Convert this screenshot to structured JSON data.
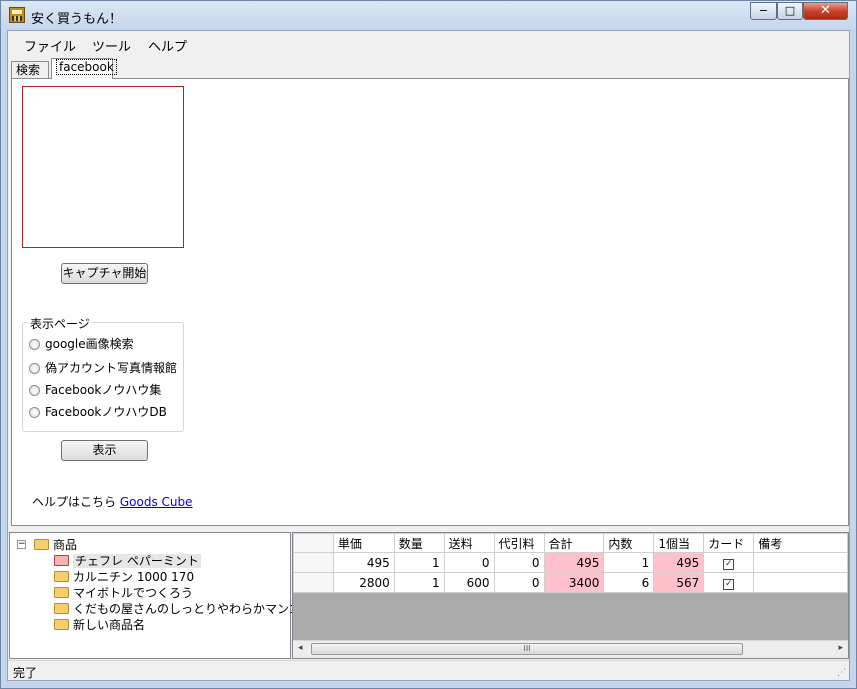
{
  "window": {
    "title": "安く買うもん！",
    "minimize": "−",
    "maximize": "□",
    "close": "✕"
  },
  "menu": [
    "ファイル",
    "ツール",
    "ヘルプ"
  ],
  "tabs": [
    {
      "label": "検索",
      "active": false
    },
    {
      "label": "facebook",
      "active": true
    }
  ],
  "capture_button": "キャプチャ開始",
  "display_group": {
    "label": "表示ページ",
    "options": [
      "google画像検索",
      "偽アカウント写真情報館",
      "Facebookノウハウ集",
      "FacebookノウハウDB"
    ]
  },
  "show_button": "表示",
  "help": {
    "text": "ヘルプはこちら",
    "link": "Goods Cube"
  },
  "tree": {
    "root": "商品",
    "expander": "−",
    "children": [
      {
        "label": "チェフレ ペパーミント",
        "selected": true
      },
      {
        "label": "カルニチン 1000 170",
        "selected": false
      },
      {
        "label": "マイボトルでつくろう",
        "selected": false
      },
      {
        "label": "くだもの屋さんのしっとりやわらかマンゴー",
        "selected": false
      },
      {
        "label": "新しい商品名",
        "selected": false
      }
    ]
  },
  "grid": {
    "columns": [
      "単価",
      "数量",
      "送料",
      "代引料",
      "合計",
      "内数",
      "1個当",
      "カード",
      "備考"
    ],
    "rows": [
      [
        "495",
        "1",
        "0",
        "0",
        "495",
        "1",
        "495",
        "✓",
        ""
      ],
      [
        "2800",
        "1",
        "600",
        "0",
        "3400",
        "6",
        "567",
        "✓",
        ""
      ]
    ],
    "scroll_left": "◂",
    "scroll_right": "▸",
    "scroll_grip": "III"
  },
  "status": {
    "text": "完了",
    "grip": "⋰"
  }
}
